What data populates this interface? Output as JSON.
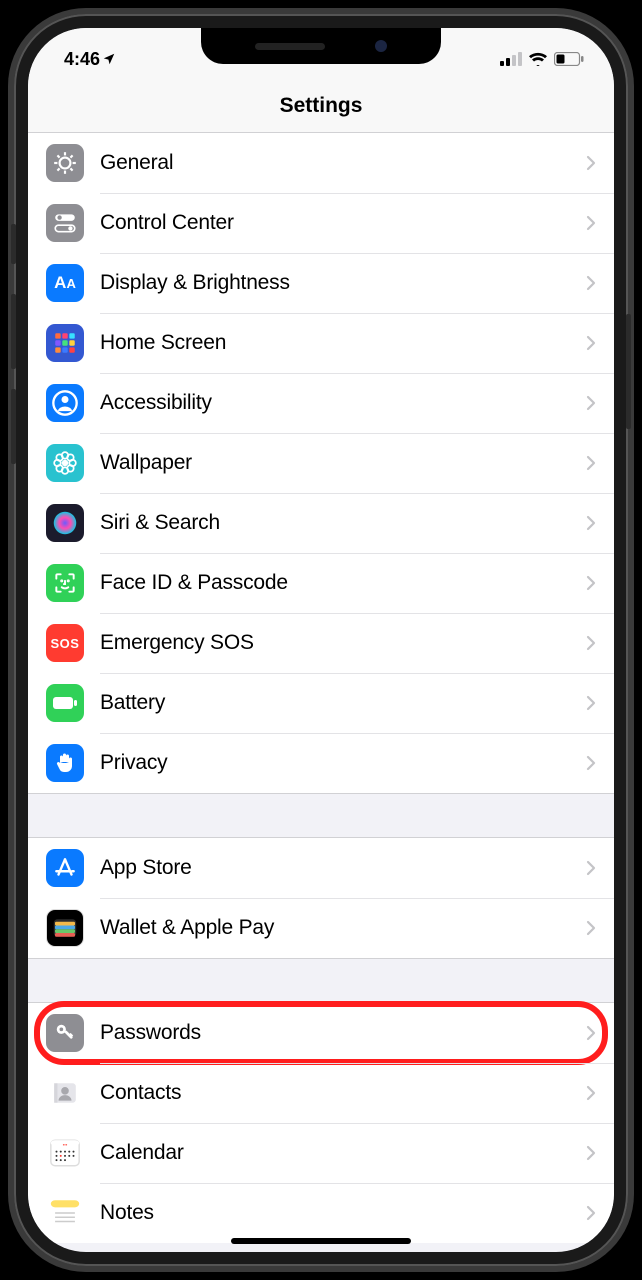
{
  "status": {
    "time": "4:46",
    "location_arrow": "↗"
  },
  "header": {
    "title": "Settings"
  },
  "groups": [
    {
      "rows": [
        {
          "id": "general",
          "label": "General",
          "icon_bg": "#8e8e93",
          "icon": "gear"
        },
        {
          "id": "control-center",
          "label": "Control Center",
          "icon_bg": "#8e8e93",
          "icon": "toggles"
        },
        {
          "id": "display-brightness",
          "label": "Display & Brightness",
          "icon_bg": "#0a7aff",
          "icon": "AA"
        },
        {
          "id": "home-screen",
          "label": "Home Screen",
          "icon_bg": "#3358d1",
          "icon": "grid"
        },
        {
          "id": "accessibility",
          "label": "Accessibility",
          "icon_bg": "#0a7aff",
          "icon": "person-circle"
        },
        {
          "id": "wallpaper",
          "label": "Wallpaper",
          "icon_bg": "#29c2cf",
          "icon": "flower"
        },
        {
          "id": "siri-search",
          "label": "Siri & Search",
          "icon_bg": "#1b1b2c",
          "icon": "siri"
        },
        {
          "id": "faceid-passcode",
          "label": "Face ID & Passcode",
          "icon_bg": "#30d158",
          "icon": "face"
        },
        {
          "id": "emergency-sos",
          "label": "Emergency SOS",
          "icon_bg": "#ff3b30",
          "icon": "SOS"
        },
        {
          "id": "battery",
          "label": "Battery",
          "icon_bg": "#30d158",
          "icon": "battery"
        },
        {
          "id": "privacy",
          "label": "Privacy",
          "icon_bg": "#0a7aff",
          "icon": "hand"
        }
      ]
    },
    {
      "rows": [
        {
          "id": "app-store",
          "label": "App Store",
          "icon_bg": "#0a7aff",
          "icon": "appstore"
        },
        {
          "id": "wallet-apple-pay",
          "label": "Wallet & Apple Pay",
          "icon_bg": "#000000",
          "icon": "wallet"
        }
      ]
    },
    {
      "rows": [
        {
          "id": "passwords",
          "label": "Passwords",
          "icon_bg": "#8e8e93",
          "icon": "key",
          "highlight": true
        },
        {
          "id": "contacts",
          "label": "Contacts",
          "icon_bg": "#c9c9ce",
          "icon": "contacts"
        },
        {
          "id": "calendar",
          "label": "Calendar",
          "icon_bg": "#ffffff",
          "icon": "calendar"
        },
        {
          "id": "notes",
          "label": "Notes",
          "icon_bg": "#ffe066",
          "icon": "notes"
        }
      ]
    }
  ],
  "icons": {
    "cell_bars": 4,
    "cell_active": 2,
    "wifi": true,
    "battery_pct": 30
  }
}
